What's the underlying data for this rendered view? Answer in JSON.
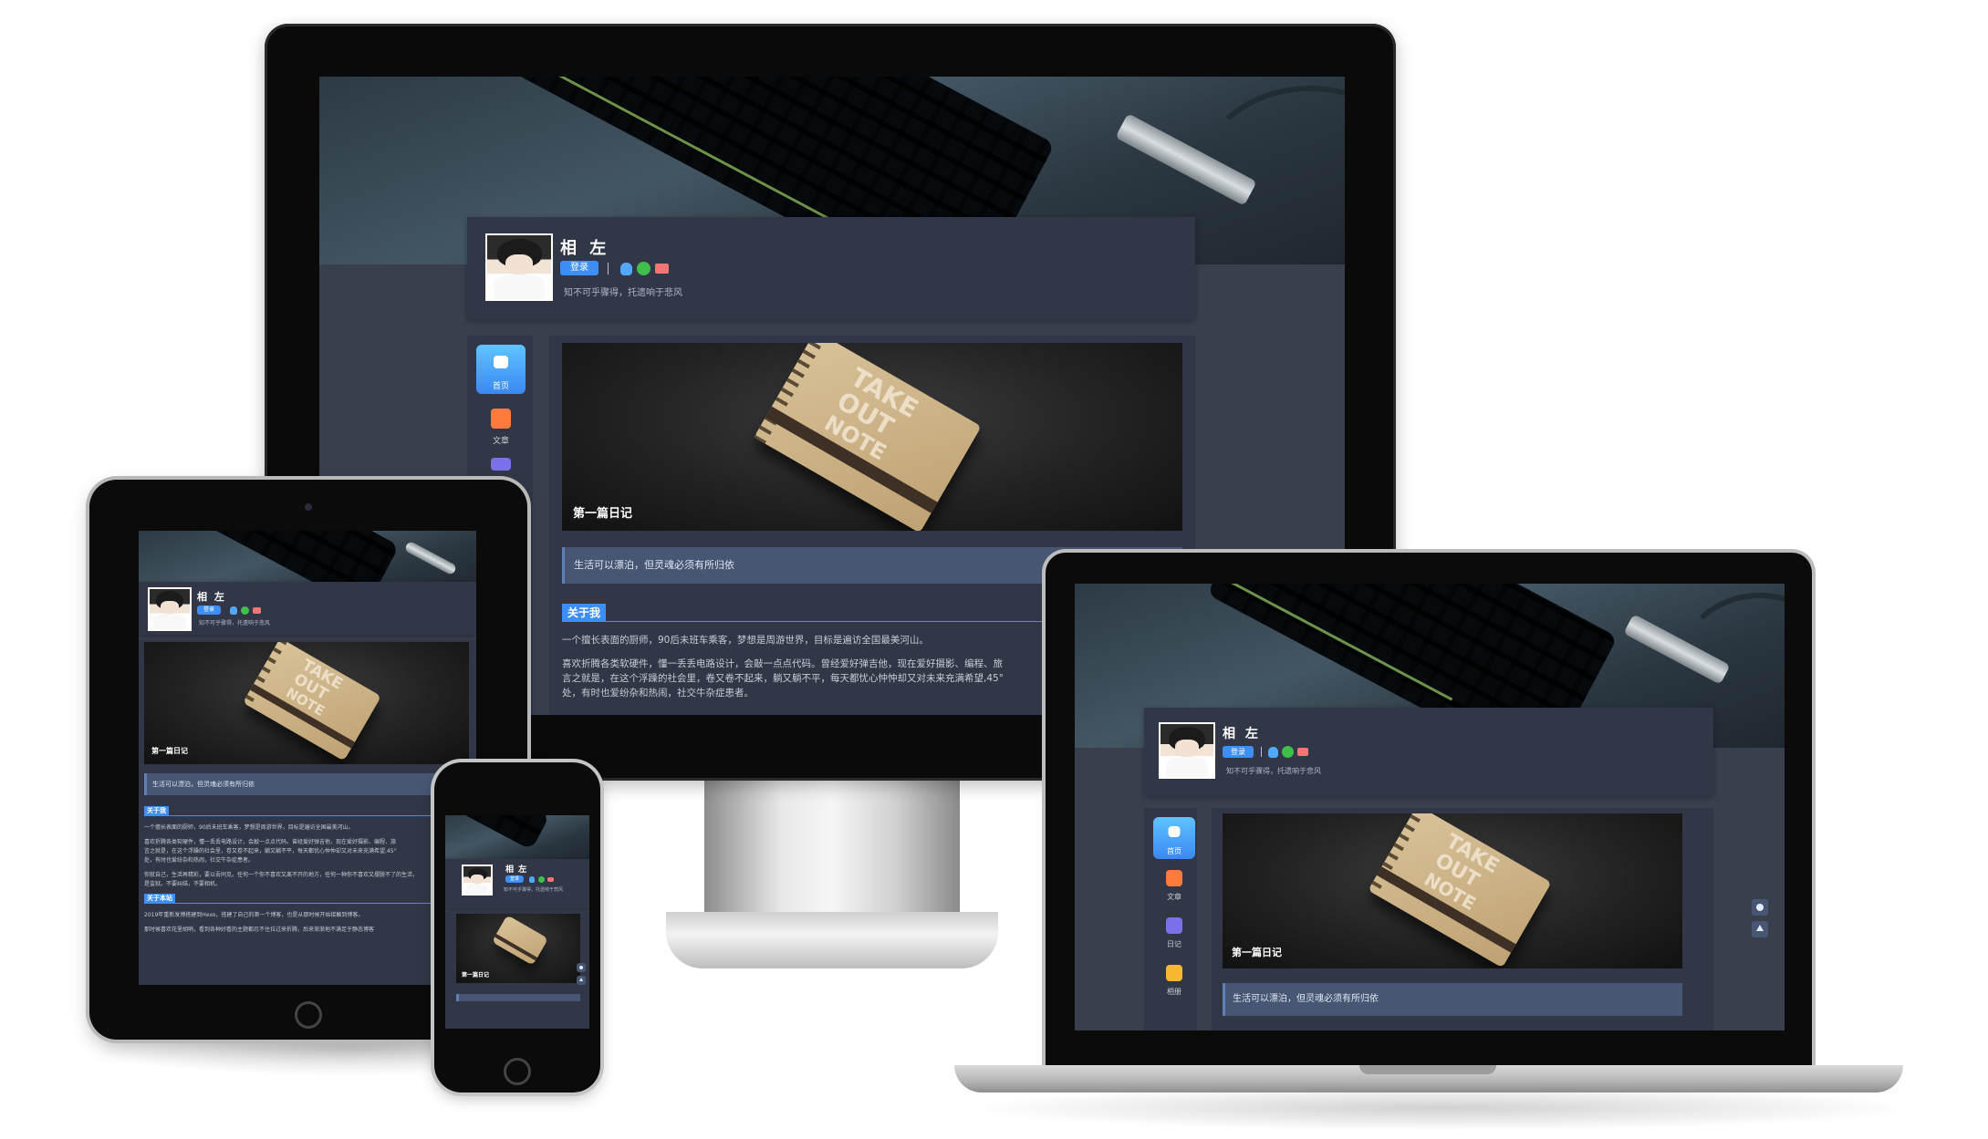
{
  "site": {
    "name": "相 左",
    "login_label": "登录",
    "motto": "知不可乎骤得，托遗响于悲风",
    "icons": [
      "qq-icon",
      "wechat-icon",
      "mail-icon"
    ]
  },
  "nav": {
    "items": [
      {
        "label": "首页",
        "icon": "home-icon",
        "color": "#3a88f2"
      },
      {
        "label": "文章",
        "icon": "article-icon",
        "color": "#ff7a3d"
      },
      {
        "label": "日记",
        "icon": "diary-icon",
        "color": "#7a72e8"
      },
      {
        "label": "相册",
        "icon": "album-icon",
        "color": "#f5b82e"
      }
    ]
  },
  "hero": {
    "title": "第一篇日记",
    "notebook_text": [
      "TAKE",
      "OUT",
      "NOTE"
    ]
  },
  "quote": "生活可以漂泊，但灵魂必须有所归依",
  "about": {
    "heading": "关于我",
    "p1": "一个擅长表面的厨师，90后未班车乘客，梦想是周游世界，目标是遍访全国最美河山。",
    "p2a": "喜欢折腾各类软硬件，懂一丢丢电路设计，会敲一点点代码。曾经爱好弹吉他，现在爱好摄影、编程、旅",
    "p2b": "言之就是，在这个浮躁的社会里，卷又卷不起来，躺又躺不平，每天都忧心忡忡却又对未来充满希望,45°",
    "p3": "处，有时也爱纷杂和热闹，社交牛杂症患者。"
  },
  "tablet_extra": {
    "p4": "你就自己，生活再精彩，要以吾同见。任何一个你不喜欢又离不开的地方，任何一种你不喜欢又摆脱不了的生活，",
    "p4b": "是监狱。不要纠结，不要相机。",
    "heading2": "关于本站",
    "p5": "2019年重新发博搭建到Hexo，搭建了自己的第一个博客，也是从那时候开始接触到博客。",
    "p6": "那时候喜欢花里胡哨，看到各种好看的主题都忍不住拉过来折腾，后来渐渐地不满足于静态博客"
  },
  "float_buttons": [
    "theme-toggle-icon",
    "back-to-top-icon"
  ]
}
